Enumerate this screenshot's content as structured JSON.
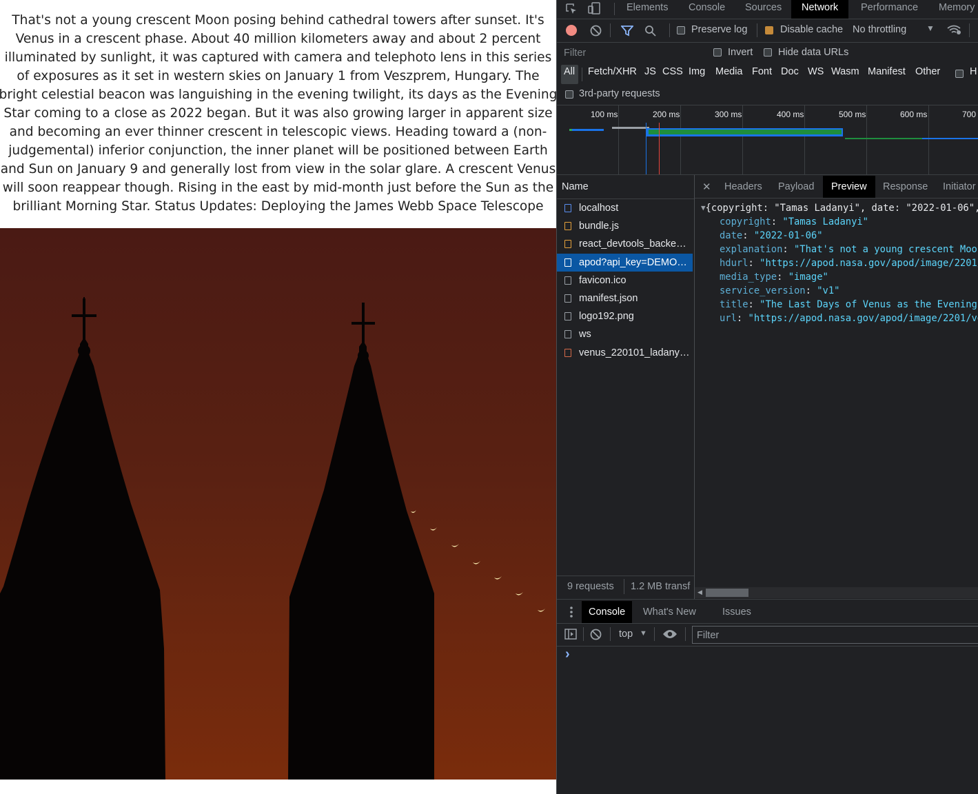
{
  "apod": {
    "explanation": "That's not a young crescent Moon posing behind cathedral towers after sunset. It's Venus in a crescent phase. About 40 million kilometers away and about 2 percent illuminated by sunlight, it was captured with camera and telephoto lens in this series of exposures as it set in western skies on January 1 from Veszprem, Hungary. The bright celestial beacon was languishing in the evening twilight, its days as the Evening Star coming to a close as 2022 began. But it was also growing larger in apparent size and becoming an ever thinner crescent in telescopic views. Heading toward a (non-judgemental) inferior conjunction, the inner planet will be positioned between Earth and Sun on January 9 and generally lost from view in the solar glare. A crescent Venus will soon reappear though. Rising in the east by mid-month just before the Sun as the brilliant Morning Star. Status Updates: Deploying the James Webb Space Telescope"
  },
  "devtools": {
    "main_tabs": [
      "Elements",
      "Console",
      "Sources",
      "Network",
      "Performance",
      "Memory"
    ],
    "active_main_tab": "Network",
    "toolbar": {
      "preserve_log": "Preserve log",
      "preserve_log_checked": false,
      "disable_cache": "Disable cache",
      "disable_cache_checked": true,
      "throttling": "No throttling"
    },
    "filter": {
      "placeholder": "Filter",
      "invert": "Invert",
      "hide_data_urls": "Hide data URLs",
      "types": [
        "All",
        "Fetch/XHR",
        "JS",
        "CSS",
        "Img",
        "Media",
        "Font",
        "Doc",
        "WS",
        "Wasm",
        "Manifest",
        "Other",
        "H"
      ],
      "third_party": "3rd-party requests"
    },
    "timeline_ticks": [
      "100 ms",
      "200 ms",
      "300 ms",
      "400 ms",
      "500 ms",
      "600 ms",
      "700"
    ],
    "requests_header": "Name",
    "requests": [
      {
        "name": "localhost",
        "icon": "document-icon",
        "selected": false
      },
      {
        "name": "bundle.js",
        "icon": "script-icon",
        "selected": false
      },
      {
        "name": "react_devtools_backend.js",
        "icon": "script-icon",
        "selected": false
      },
      {
        "name": "apod?api_key=DEMO_KEY",
        "icon": "fetch-icon",
        "selected": true
      },
      {
        "name": "favicon.ico",
        "icon": "file-icon",
        "selected": false
      },
      {
        "name": "manifest.json",
        "icon": "file-icon",
        "selected": false
      },
      {
        "name": "logo192.png",
        "icon": "file-icon",
        "selected": false
      },
      {
        "name": "ws",
        "icon": "file-icon",
        "selected": false
      },
      {
        "name": "venus_220101_ladanyi.jpg",
        "icon": "image-icon",
        "selected": false
      }
    ],
    "summary": {
      "requests": "9 requests",
      "transferred": "1.2 MB transf"
    },
    "detail_tabs": [
      "Headers",
      "Payload",
      "Preview",
      "Response",
      "Initiator"
    ],
    "active_detail_tab": "Preview",
    "preview": {
      "summary": "{copyright: \"Tamas Ladanyi\", date: \"2022-01-06\",",
      "fields": [
        {
          "key": "copyright",
          "value": "\"Tamas Ladanyi\""
        },
        {
          "key": "date",
          "value": "\"2022-01-06\""
        },
        {
          "key": "explanation",
          "value": "\"That's not a young crescent Moon"
        },
        {
          "key": "hdurl",
          "value": "\"https://apod.nasa.gov/apod/image/2201/"
        },
        {
          "key": "media_type",
          "value": "\"image\""
        },
        {
          "key": "service_version",
          "value": "\"v1\""
        },
        {
          "key": "title",
          "value": "\"The Last Days of Venus as the Evening"
        },
        {
          "key": "url",
          "value": "\"https://apod.nasa.gov/apod/image/2201/ve"
        }
      ]
    },
    "drawer": {
      "tabs": [
        "Console",
        "What's New",
        "Issues"
      ],
      "active": "Console",
      "context": "top",
      "filter_placeholder": "Filter",
      "prompt": "›"
    },
    "colors": {
      "bg": "#202124",
      "selected": "#0b57a3",
      "json_key": "#5db0d7",
      "json_string": "#5cd5fb",
      "record": "#f28b82"
    }
  }
}
